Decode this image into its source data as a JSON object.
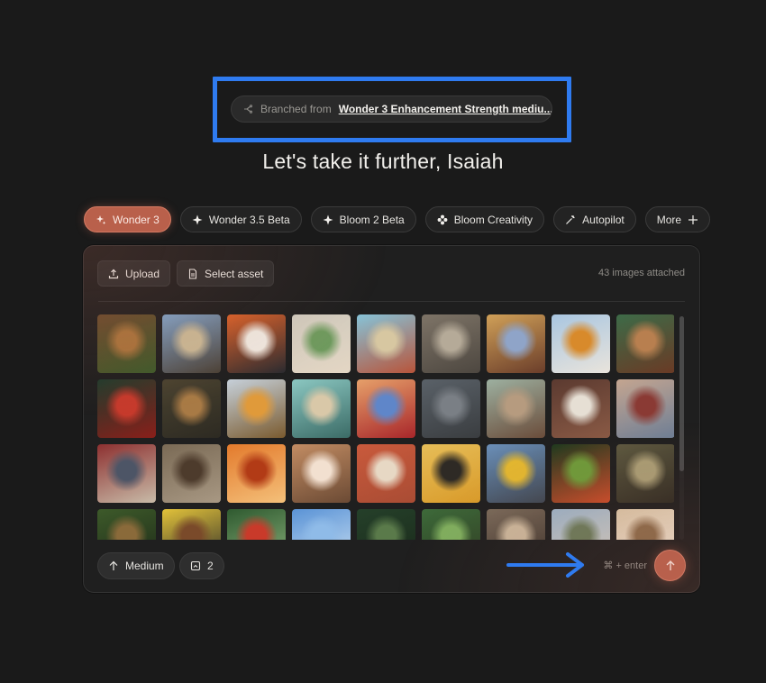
{
  "branch": {
    "prefix": "Branched from",
    "link": "Wonder 3 Enhancement Strength mediu..."
  },
  "headline": "Let's take it further, Isaiah",
  "models": [
    {
      "label": "Wonder 3",
      "icon": "sparkle-icon",
      "active": true
    },
    {
      "label": "Wonder 3.5 Beta",
      "icon": "star-icon",
      "active": false
    },
    {
      "label": "Bloom 2 Beta",
      "icon": "star-icon",
      "active": false
    },
    {
      "label": "Bloom Creativity",
      "icon": "flower-icon",
      "active": false
    },
    {
      "label": "Autopilot",
      "icon": "magic-wand-icon",
      "active": false
    },
    {
      "label": "More",
      "icon": "plus-icon",
      "active": false
    }
  ],
  "toolbar": {
    "upload_label": "Upload",
    "select_asset_label": "Select asset",
    "attached_text": "43 images attached"
  },
  "footer": {
    "quality_label": "Medium",
    "count_label": "2",
    "shortcut_text": "⌘ + enter"
  },
  "colors": {
    "accent": "#b8604c",
    "annotation_blue": "#2f7bf0"
  },
  "thumbnails": [
    "market-vendor",
    "big-ben",
    "man-portrait-orange",
    "woman-flowers",
    "retro-sign-desert",
    "ornate-building",
    "colorful-city-woman",
    "woman-yellow-dress",
    "woman-painting",
    "hummingbird-red-flowers",
    "dancer-motion",
    "autumn-tower",
    "man-guitar-mural",
    "neon-sign-sunset",
    "man-grey-backdrop",
    "woman-knit-shawl",
    "couple-portrait",
    "colorful-facades",
    "man-red-wall",
    "bagpiper-brick",
    "dancer-orange",
    "woman-white-gown",
    "woman-tennis-court",
    "man-sunglasses-yellow",
    "yellow-tram",
    "hummingbird-green",
    "woman-sitting-field",
    "woman-garden",
    "man-yellow-wall",
    "bird-flowers",
    "sky-blue",
    "woman-plants",
    "leaf-green",
    "woman-curly-hair",
    "mountain-valley",
    "woman-blonde"
  ]
}
